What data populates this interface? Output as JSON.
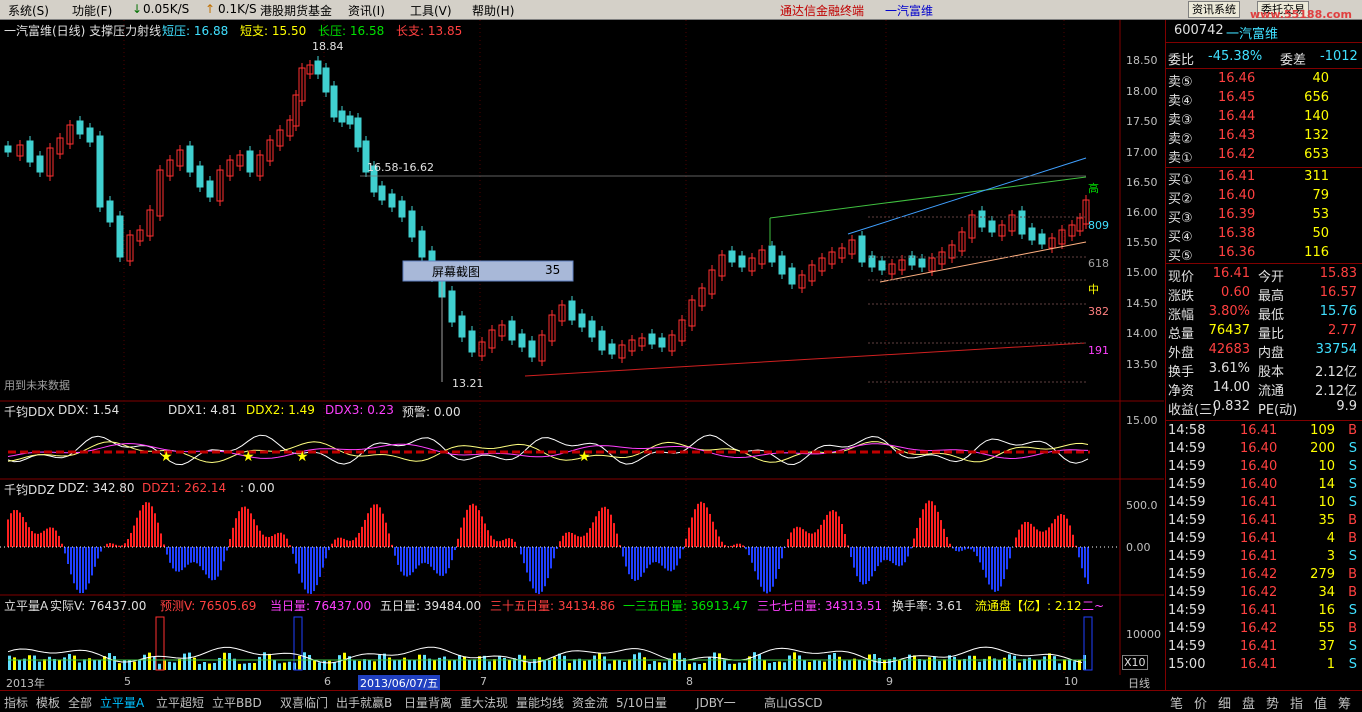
{
  "menu": {
    "items": [
      "系统(S)",
      "功能(F)",
      "0.05K/S",
      "0.1K/S",
      "港股期货基金",
      "资讯(I)",
      "工具(V)",
      "帮助(H)"
    ],
    "brand": "通达信金融终端",
    "stock_name": "一汽富维",
    "btn_info": "资讯系统",
    "btn_trade": "委托交易",
    "watermark": "www.55188.com"
  },
  "main_chart": {
    "title": "一汽富维(日线) 支撑压力射线",
    "short_press_label": "短压: 16.88",
    "short_support_label": "短支: 15.50",
    "long_press_label": "长压: 16.58",
    "long_support_label": "长支: 13.85",
    "high_mark": "18.84",
    "low_mark": "13.21",
    "range_label": "16.58-16.62",
    "future_note": "用到未来数据",
    "levels": {
      "gao": "高",
      "l809": "809",
      "l618": "618",
      "zhong": "中",
      "l382": "382",
      "l191": "191"
    },
    "y_ticks": [
      "18.50",
      "18.00",
      "17.50",
      "17.00",
      "16.50",
      "16.00",
      "15.50",
      "15.00",
      "14.50",
      "14.00",
      "13.50"
    ],
    "tooltip_label": "屏幕截图",
    "tooltip_value": "35"
  },
  "ddx": {
    "name": "千钧DDX",
    "ddx": "DDX: 1.54",
    "ddx1": "DDX1: 4.81",
    "ddx2": "DDX2: 1.49",
    "ddx3": "DDX3: 0.23",
    "warn": "预警: 0.00",
    "tick": "15.00"
  },
  "ddz": {
    "name": "千钧DDZ",
    "ddz": "DDZ: 342.80",
    "ddz1": "DDZ1: 262.14",
    "extra": ": 0.00",
    "tick_top": "500.0",
    "tick_zero": "0.00"
  },
  "vol": {
    "name": "立平量A",
    "actual": "实际V: 76437.00",
    "pred": "预测V: 76505.69",
    "today": "当日量: 76437.00",
    "d5": "五日量: 39484.00",
    "d35": "三十五日量: 34134.86",
    "d135": "一三五日量: 36913.47",
    "d377": "三七七日量: 34313.51",
    "turnover": "换手率: 3.61",
    "float": "流通盘【亿】: 2.12",
    "tail": "二~",
    "tick": "10000",
    "x10": "X10"
  },
  "dates": {
    "year": "2013年",
    "m5": "5",
    "m6": "6",
    "cursor_date": "2013/06/07/五",
    "m7": "7",
    "m8": "8",
    "m9": "9",
    "m10": "10",
    "period": "日线"
  },
  "quote": {
    "code": "600742",
    "name": "一汽富维",
    "weibi_label": "委比",
    "weibi": "-45.38%",
    "weicha_label": "委差",
    "weicha": "-1012",
    "sells": [
      {
        "label": "卖⑤",
        "price": "16.46",
        "vol": "40"
      },
      {
        "label": "卖④",
        "price": "16.45",
        "vol": "656"
      },
      {
        "label": "卖③",
        "price": "16.44",
        "vol": "140"
      },
      {
        "label": "卖②",
        "price": "16.43",
        "vol": "132"
      },
      {
        "label": "卖①",
        "price": "16.42",
        "vol": "653"
      }
    ],
    "buys": [
      {
        "label": "买①",
        "price": "16.41",
        "vol": "311"
      },
      {
        "label": "买②",
        "price": "16.40",
        "vol": "79"
      },
      {
        "label": "买③",
        "price": "16.39",
        "vol": "53"
      },
      {
        "label": "买④",
        "price": "16.38",
        "vol": "50"
      },
      {
        "label": "买⑤",
        "price": "16.36",
        "vol": "116"
      }
    ],
    "stats": [
      {
        "l1": "现价",
        "v1": "16.41",
        "l2": "今开",
        "v2": "15.83"
      },
      {
        "l1": "涨跌",
        "v1": "0.60",
        "l2": "最高",
        "v2": "16.57"
      },
      {
        "l1": "涨幅",
        "v1": "3.80%",
        "l2": "最低",
        "v2": "15.76"
      },
      {
        "l1": "总量",
        "v1": "76437",
        "l2": "量比",
        "v2": "2.77"
      },
      {
        "l1": "外盘",
        "v1": "42683",
        "l2": "内盘",
        "v2": "33754"
      },
      {
        "l1": "换手",
        "v1": "3.61%",
        "l2": "股本",
        "v2": "2.12亿"
      },
      {
        "l1": "净资",
        "v1": "14.00",
        "l2": "流通",
        "v2": "2.12亿"
      },
      {
        "l1": "收益(三)",
        "v1": "0.832",
        "l2": "PE(动)",
        "v2": "9.9"
      }
    ],
    "ticks": [
      {
        "t": "14:58",
        "p": "16.41",
        "v": "109",
        "d": "B"
      },
      {
        "t": "14:59",
        "p": "16.40",
        "v": "200",
        "d": "S"
      },
      {
        "t": "14:59",
        "p": "16.40",
        "v": "10",
        "d": "S"
      },
      {
        "t": "14:59",
        "p": "16.40",
        "v": "14",
        "d": "S"
      },
      {
        "t": "14:59",
        "p": "16.41",
        "v": "10",
        "d": "S"
      },
      {
        "t": "14:59",
        "p": "16.41",
        "v": "35",
        "d": "B"
      },
      {
        "t": "14:59",
        "p": "16.41",
        "v": "4",
        "d": "B"
      },
      {
        "t": "14:59",
        "p": "16.41",
        "v": "3",
        "d": "S"
      },
      {
        "t": "14:59",
        "p": "16.42",
        "v": "279",
        "d": "B"
      },
      {
        "t": "14:59",
        "p": "16.42",
        "v": "34",
        "d": "B"
      },
      {
        "t": "14:59",
        "p": "16.41",
        "v": "16",
        "d": "S"
      },
      {
        "t": "14:59",
        "p": "16.42",
        "v": "55",
        "d": "B"
      },
      {
        "t": "14:59",
        "p": "16.41",
        "v": "37",
        "d": "S"
      },
      {
        "t": "15:00",
        "p": "16.41",
        "v": "1",
        "d": "S"
      }
    ]
  },
  "bottom_tabs": [
    "指标",
    "模板",
    "全部",
    "立平量A",
    "立平超短",
    "立平BBD",
    "双喜临门",
    "出手就赢B",
    "日量背离",
    "重大法现",
    "量能均线",
    "资金流",
    "5/10日量",
    "JDBY一",
    "高山GSCD"
  ],
  "right_tabs": [
    "笔",
    "价",
    "细",
    "盘",
    "势",
    "指",
    "值",
    "筹"
  ]
}
